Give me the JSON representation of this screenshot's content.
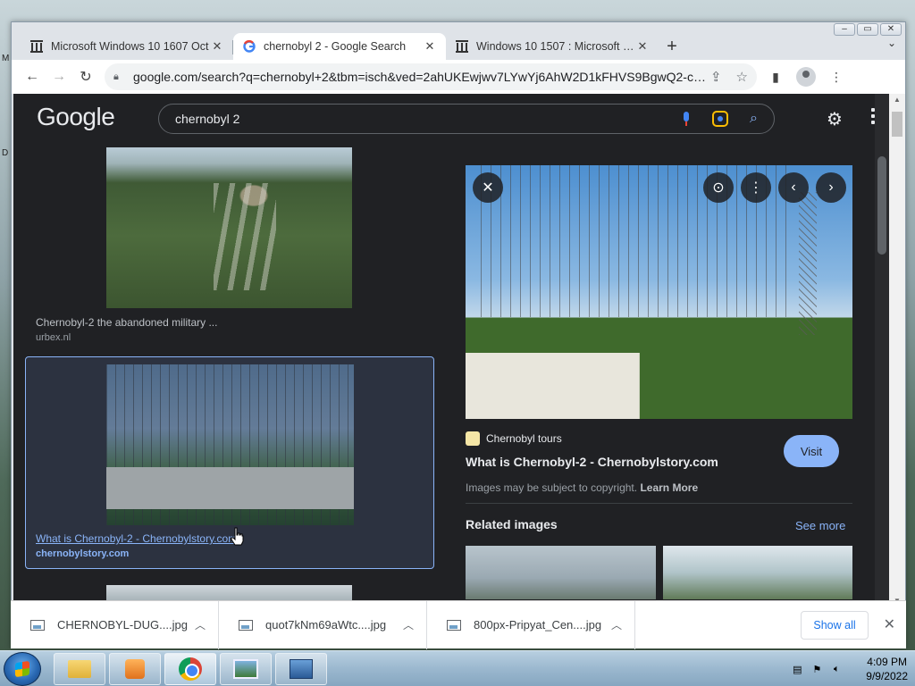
{
  "tabs": [
    {
      "title": "Microsoft Windows 10 1607 Oct",
      "icon": "archive-icon",
      "active": false
    },
    {
      "title": "chernobyl 2 - Google Search",
      "icon": "google-icon",
      "active": true
    },
    {
      "title": "Windows 10 1507 : Microsoft : Fr",
      "icon": "archive-icon",
      "active": false
    }
  ],
  "toolbar": {
    "url": "google.com/search?q=chernobyl+2&tbm=isch&ved=2ahUKEwjwv7LYwYj6AhW2D1kFHVS9BgwQ2-cCegQI..."
  },
  "google": {
    "logo": "Google",
    "query": "chernobyl 2"
  },
  "results": [
    {
      "title": "Chernobyl-2 the abandoned military ...",
      "domain": "urbex.nl"
    },
    {
      "title": "What is Chernobyl-2 - Chernobylstory.com",
      "domain": "chernobylstory.com"
    }
  ],
  "preview": {
    "source": "Chernobyl tours",
    "title": "What is Chernobyl-2 - Chernobylstory.com",
    "visit_label": "Visit",
    "copyright_text": "Images may be subject to copyright.",
    "learn_more": "Learn More",
    "related_label": "Related images",
    "see_more": "See more"
  },
  "downloads": [
    {
      "name": "CHERNOBYL-DUG....jpg"
    },
    {
      "name": "quot7kNm69aWtc....jpg"
    },
    {
      "name": "800px-Pripyat_Cen....jpg"
    }
  ],
  "shelf": {
    "show_all": "Show all"
  },
  "taskbar": {
    "time": "4:09 PM",
    "date": "9/9/2022"
  },
  "colors": {
    "accent": "#8ab4f8",
    "bg_dark": "#202124"
  }
}
